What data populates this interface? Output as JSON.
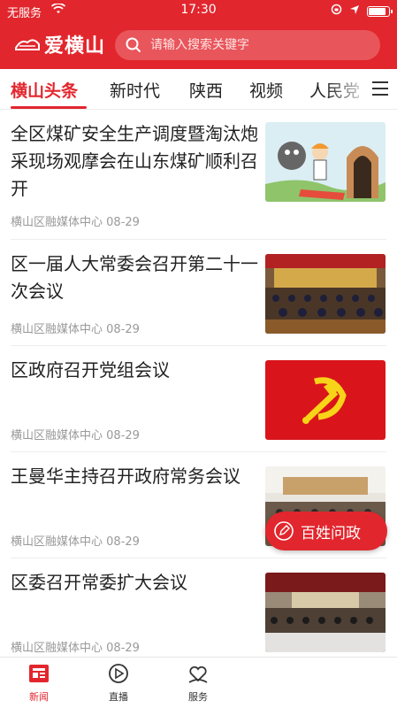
{
  "status_bar": {
    "carrier": "无服务",
    "time": "17:30"
  },
  "header": {
    "app_name": "爱横山",
    "search_placeholder": "请输入搜索关键字"
  },
  "tabs": [
    {
      "label": "横山头条",
      "active": true
    },
    {
      "label": "新时代",
      "active": false
    },
    {
      "label": "陕西",
      "active": false
    },
    {
      "label": "视频",
      "active": false
    },
    {
      "label": "人民党",
      "active": false
    }
  ],
  "news": [
    {
      "title": "全区煤矿安全生产调度暨淘汰炮采现场观摩会在山东煤矿顺利召开",
      "source": "横山区融媒体中心",
      "date": "08-29",
      "thumb": "cartoon-coal-mine"
    },
    {
      "title": "区一届人大常委会召开第二十一次会议",
      "source": "横山区融媒体中心",
      "date": "08-29",
      "thumb": "meeting-hall"
    },
    {
      "title": "区政府召开党组会议",
      "source": "横山区融媒体中心",
      "date": "08-29",
      "thumb": "party-flag"
    },
    {
      "title": "王曼华主持召开政府常务会议",
      "source": "横山区融媒体中心",
      "date": "08-29",
      "thumb": "conference-room"
    },
    {
      "title": "区委召开常委扩大会议",
      "source": "横山区融媒体中心",
      "date": "08-29",
      "thumb": "conference-room-2"
    }
  ],
  "float_button": {
    "label": "百姓问政"
  },
  "bottom_nav": [
    {
      "label": "新闻",
      "icon": "news-icon",
      "active": true
    },
    {
      "label": "直播",
      "icon": "play-icon",
      "active": false
    },
    {
      "label": "服务",
      "icon": "service-icon",
      "active": false
    }
  ],
  "colors": {
    "brand": "#e2262d"
  }
}
